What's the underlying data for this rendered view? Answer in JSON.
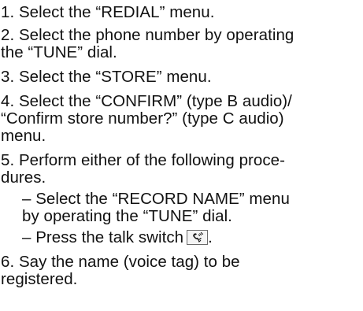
{
  "lines": {
    "l1": "1.  Select the “REDIAL” menu.",
    "l2": "2.  Select the phone number by operating",
    "l3": "the “TUNE” dial.",
    "l4": "3.  Select the “STORE” menu.",
    "l5": "4.  Select the “CONFIRM” (type B audio)/",
    "l6": "“Confirm store number?” (type C audio)",
    "l7": "menu.",
    "l8": "5.  Perform either of the following proce-",
    "l9": "dures.",
    "l10": "– Select the “RECORD NAME” menu",
    "l11": "by operating the “TUNE” dial.",
    "l12": "– Press the talk switch",
    "l12_end": ".",
    "l13": "6.  Say  the  name  (voice  tag)  to  be",
    "l14": "registered."
  },
  "icons": {
    "talk_switch": "talk-switch-icon"
  }
}
